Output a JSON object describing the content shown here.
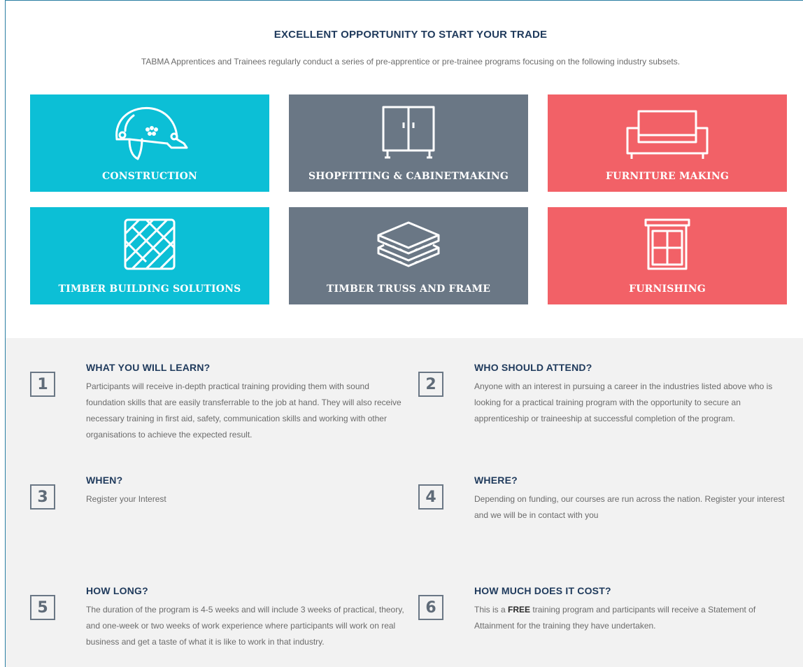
{
  "heading": "EXCELLENT OPPORTUNITY TO START YOUR TRADE",
  "intro": "TABMA Apprentices and Trainees regularly conduct a series of pre-apprentice or pre-trainee programs focusing on the following industry subsets.",
  "colors": {
    "teal": "#0cbfd6",
    "slate": "#6a7785",
    "coral": "#f26167",
    "heading": "#1f3a5c"
  },
  "tiles": [
    {
      "label": "CONSTRUCTION",
      "icon": "hard-hat-icon"
    },
    {
      "label": "SHOPFITTING & CABINETMAKING",
      "icon": "cabinet-icon"
    },
    {
      "label": "FURNITURE MAKING",
      "icon": "sofa-icon"
    },
    {
      "label": "TIMBER BUILDING SOLUTIONS",
      "icon": "parquet-icon"
    },
    {
      "label": "TIMBER TRUSS AND FRAME",
      "icon": "stacked-panels-icon"
    },
    {
      "label": "FURNISHING",
      "icon": "window-icon"
    }
  ],
  "items": [
    {
      "number": "1",
      "title": "WHAT YOU WILL LEARN?",
      "text": "Participants will receive in-depth practical training providing them with sound foundation skills that are easily transferrable to the job at hand. They will also receive necessary training in first aid, safety, communication skills and working with other organisations to achieve the expected result."
    },
    {
      "number": "2",
      "title": "WHO SHOULD ATTEND?",
      "text": "Anyone with an interest in pursuing a career in the industries listed above who is looking for a practical training program with the opportunity to secure an apprenticeship or traineeship at successful completion of the program."
    },
    {
      "number": "3",
      "title": "WHEN?",
      "text": "Register your Interest"
    },
    {
      "number": "4",
      "title": "WHERE?",
      "text": "Depending on funding, our courses are run across the nation. Register your interest and we will be in contact with you"
    },
    {
      "number": "5",
      "title": "HOW LONG?",
      "text": "The duration of the program is 4-5 weeks and will include 3 weeks of practical, theory, and one-week or two weeks of work experience where participants will work on real business and get a taste of what it is like to work in that industry."
    },
    {
      "number": "6",
      "title": "HOW MUCH DOES IT COST?",
      "text_before": "This is a ",
      "text_bold": "FREE",
      "text_after": " training program and participants will receive a Statement of Attainment for the training they have undertaken."
    }
  ]
}
